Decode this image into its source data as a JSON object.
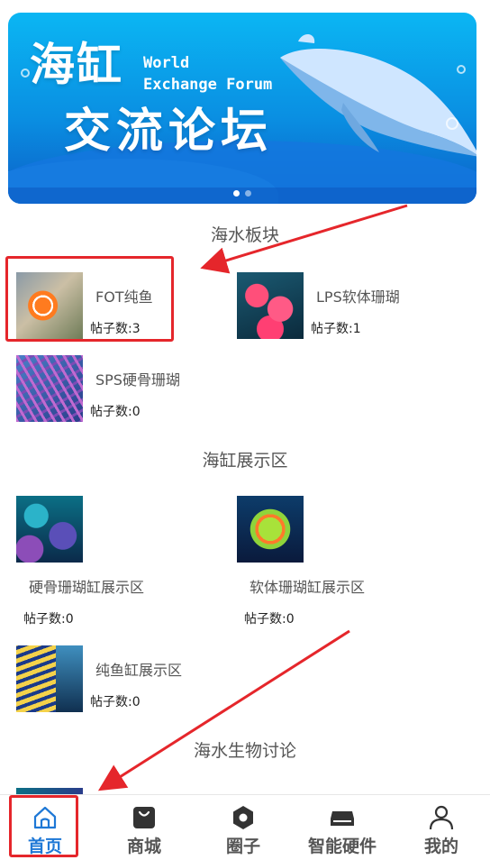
{
  "banner": {
    "title_line1": "海缸",
    "title_line2": "交流论坛",
    "subtitle_line1": "World",
    "subtitle_line2": "Exchange Forum",
    "slide_count": 2,
    "active_slide": 1
  },
  "sections": [
    {
      "title": "海水板块",
      "items": [
        {
          "name": "FOT纯鱼",
          "count": "帖子数:3",
          "image": "clownfish"
        },
        {
          "name": "LPS软体珊瑚",
          "count": "帖子数:1",
          "image": "lps-coral"
        },
        {
          "name": "SPS硬骨珊瑚",
          "count": "帖子数:0",
          "image": "sps-coral"
        }
      ]
    },
    {
      "title": "海缸展示区",
      "items": [
        {
          "name": "硬骨珊瑚缸展示区",
          "count": "帖子数:0",
          "image": "reef-tank"
        },
        {
          "name": "软体珊瑚缸展示区",
          "count": "帖子数:0",
          "image": "soft-coral"
        },
        {
          "name": "纯鱼缸展示区",
          "count": "帖子数:0",
          "image": "angelfish"
        }
      ]
    },
    {
      "title": "海水生物讨论",
      "items": []
    }
  ],
  "tabbar": {
    "tabs": [
      {
        "label": "首页",
        "icon": "home-icon",
        "active": true
      },
      {
        "label": "商城",
        "icon": "shopping-bag-icon",
        "active": false
      },
      {
        "label": "圈子",
        "icon": "hexagon-icon",
        "active": false
      },
      {
        "label": "智能硬件",
        "icon": "device-icon",
        "active": false
      },
      {
        "label": "我的",
        "icon": "user-icon",
        "active": false
      }
    ]
  },
  "colors": {
    "accent": "#1e78d6",
    "annotation": "#e5262b",
    "banner_top": "#0bb6f3",
    "banner_bottom": "#0c5fc7"
  }
}
